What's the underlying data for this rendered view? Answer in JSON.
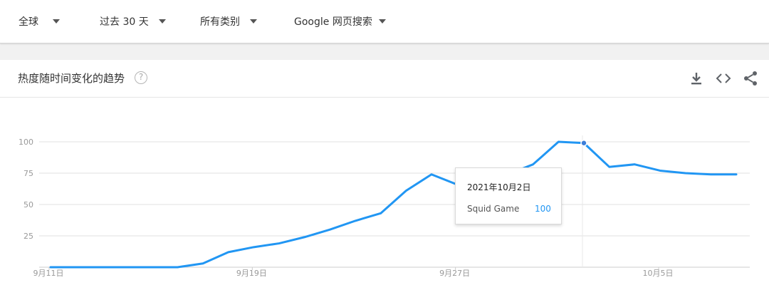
{
  "filters": {
    "region": "全球",
    "time": "过去 30 天",
    "category": "所有类别",
    "search_type": "Google 网页搜索"
  },
  "card": {
    "title": "热度随时间变化的趋势",
    "help_glyph": "?",
    "icons": [
      "download-icon",
      "embed-code-icon",
      "share-icon"
    ]
  },
  "tooltip": {
    "date": "2021年10月2日",
    "series_name": "Squid Game",
    "value": "100"
  },
  "colors": {
    "line": "#2196f3",
    "grid": "#e0e0e0",
    "tick": "#999999"
  },
  "chart_data": {
    "type": "line",
    "x_tick_labels": [
      "9月11日",
      "9月19日",
      "9月27日",
      "10月5日"
    ],
    "y_tick_labels": [
      "100",
      "75",
      "50",
      "25"
    ],
    "ylim": [
      0,
      100
    ],
    "x": [
      "9月11日",
      "9月12日",
      "9月13日",
      "9月14日",
      "9月15日",
      "9月16日",
      "9月17日",
      "9月18日",
      "9月19日",
      "9月20日",
      "9月21日",
      "9月22日",
      "9月23日",
      "9月24日",
      "9月25日",
      "9月26日",
      "9月27日",
      "9月28日",
      "9月29日",
      "9月30日",
      "10月1日",
      "10月2日",
      "10月3日",
      "10月4日",
      "10月5日",
      "10月6日",
      "10月7日",
      "10月8日"
    ],
    "series": [
      {
        "name": "Squid Game",
        "values": [
          0,
          0,
          0,
          0,
          0,
          0,
          3,
          12,
          16,
          19,
          24,
          30,
          37,
          43,
          61,
          74,
          66,
          66,
          74,
          82,
          100,
          99,
          80,
          82,
          77,
          75,
          74,
          74
        ]
      }
    ],
    "highlight_index": 21,
    "grid": true
  }
}
